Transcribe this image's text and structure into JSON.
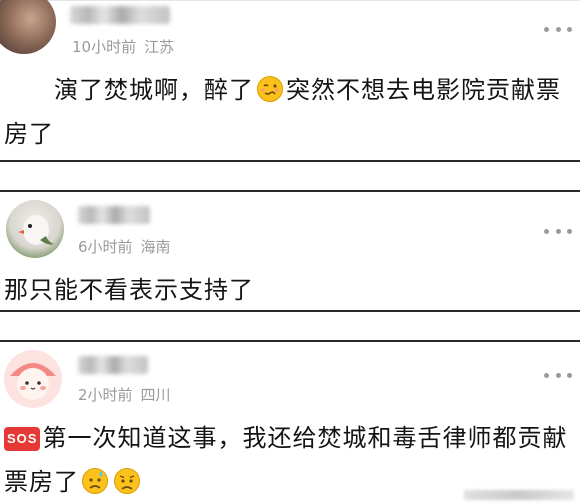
{
  "comments": [
    {
      "time": "10小时前",
      "location": "江苏",
      "text_before_emoji": "演了焚城啊，醉了",
      "emoji": "woozy-face-icon",
      "text_after_emoji": "突然不想去电影院贡献票房了"
    },
    {
      "time": "6小时前",
      "location": "海南",
      "text": "那只能不看表示支持了"
    },
    {
      "time": "2小时前",
      "location": "四川",
      "sos_label": "SOS",
      "text": "第一次知道这事，我还给焚城和毒舌律师都贡献票房了",
      "emojis": [
        "sad-sweat-face-icon",
        "worried-face-icon"
      ]
    }
  ],
  "colors": {
    "meta": "#9a9a9a",
    "text": "#141414",
    "sos": "#e53935",
    "divider": "#2a2a2a"
  }
}
